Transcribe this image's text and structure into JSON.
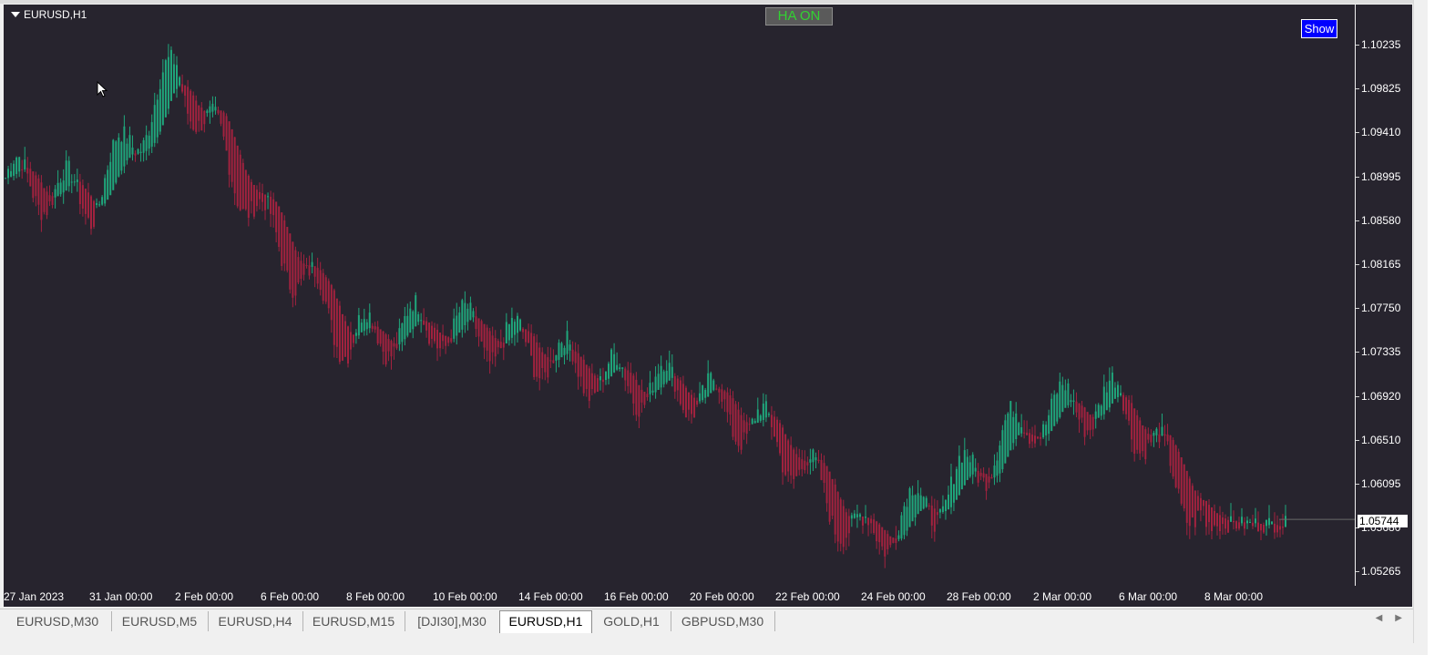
{
  "chart": {
    "title": "EURUSD,H1",
    "ha_button_label": "HA ON",
    "show_button_label": "Show",
    "current_price": "1.05744",
    "colors": {
      "background": "#27242e",
      "bull": "#1fa77c",
      "bear": "#a3223f",
      "ha_on_text": "#32d232",
      "show_button": "#0000ff"
    }
  },
  "price_axis": {
    "labels": [
      "1.10235",
      "1.09825",
      "1.09410",
      "1.08995",
      "1.08580",
      "1.08165",
      "1.07750",
      "1.07335",
      "1.06920",
      "1.06510",
      "1.06095",
      "1.05680",
      "1.05265"
    ]
  },
  "time_axis": {
    "labels": [
      "27 Jan 2023",
      "31 Jan 00:00",
      "2 Feb 00:00",
      "6 Feb 00:00",
      "8 Feb 00:00",
      "10 Feb 00:00",
      "14 Feb 00:00",
      "16 Feb 00:00",
      "20 Feb 00:00",
      "22 Feb 00:00",
      "24 Feb 00:00",
      "28 Feb 00:00",
      "2 Mar 00:00",
      "6 Mar 00:00",
      "8 Mar 00:00"
    ]
  },
  "chart_data": {
    "type": "line",
    "title": "",
    "xlabel": "",
    "ylabel": "",
    "ylim": [
      1.0515,
      1.1035
    ],
    "x": [
      "27 Jan 2023",
      "31 Jan 00:00",
      "2 Feb 00:00",
      "6 Feb 00:00",
      "8 Feb 00:00",
      "10 Feb 00:00",
      "14 Feb 00:00",
      "16 Feb 00:00",
      "20 Feb 00:00",
      "22 Feb 00:00",
      "24 Feb 00:00",
      "28 Feb 00:00",
      "2 Mar 00:00",
      "6 Mar 00:00",
      "8 Mar 00:00"
    ],
    "series": [
      {
        "values": [
          1.088,
          1.086,
          1.0975,
          1.084,
          1.0735,
          1.075,
          1.073,
          1.07,
          1.069,
          1.0645,
          1.0555,
          1.06,
          1.067,
          1.068,
          1.057
        ]
      }
    ]
  },
  "tabs": [
    {
      "label": "EURUSD,M30"
    },
    {
      "label": "EURUSD,M5"
    },
    {
      "label": "EURUSD,H4"
    },
    {
      "label": "EURUSD,M15"
    },
    {
      "label": "[DJI30],M30"
    },
    {
      "label": "EURUSD,H1"
    },
    {
      "label": "GOLD,H1"
    },
    {
      "label": "GBPUSD,M30"
    }
  ],
  "active_tab": "EURUSD,H1"
}
